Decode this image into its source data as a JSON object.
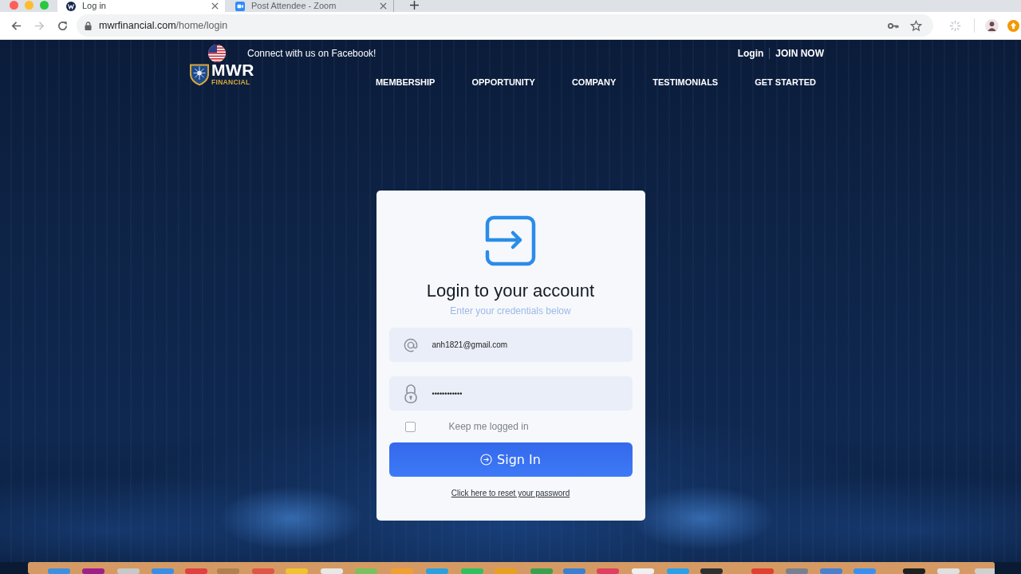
{
  "browser": {
    "tabs": [
      {
        "title": "Log in",
        "selected": true
      },
      {
        "title": "Post Attendee - Zoom",
        "selected": false
      }
    ],
    "forward_disabled": true,
    "url_host": "mwrfinancial.com",
    "url_path": "/home/login"
  },
  "topbar": {
    "facebook_text": "Connect with us on Facebook!",
    "links": [
      "Login",
      "JOIN NOW"
    ]
  },
  "logo": {
    "wordmark": "MWR",
    "tagline": "FINANCIAL"
  },
  "nav": [
    "MEMBERSHIP",
    "OPPORTUNITY",
    "COMPANY",
    "TESTIMONIALS",
    "GET STARTED"
  ],
  "login": {
    "title": "Login to your account",
    "subtitle": "Enter your credentials below",
    "fields": [
      {
        "kind": "email",
        "value": "anh1821@gmail.com"
      },
      {
        "kind": "password",
        "value": "••••••••••••"
      }
    ],
    "remember": {
      "label": "Keep me logged in",
      "checked": false
    },
    "submit": "Sign In",
    "reset_link": "Click here to reset your password"
  }
}
